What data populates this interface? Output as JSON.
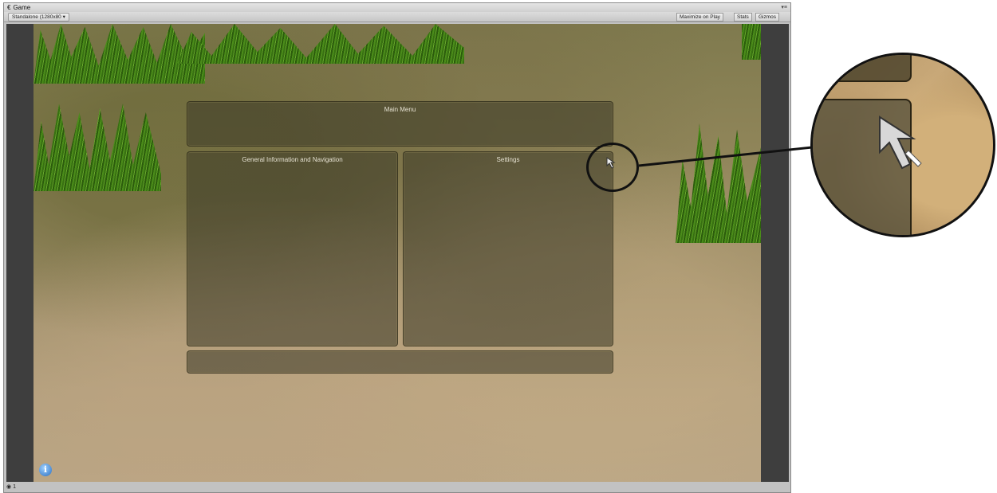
{
  "window": {
    "title": "Game",
    "aspect": "Standalone (1280x80",
    "buttons": [
      "Maximize on Play",
      "Stats",
      "Gizmos"
    ]
  },
  "menu": {
    "title": "Main Menu",
    "left_panel": "General Information and Navigation",
    "right_panel": "Settings"
  },
  "status": "1",
  "colors": {
    "panel": "#3a3826",
    "label": "#e6e2d2",
    "grass": "#4f8a22"
  }
}
